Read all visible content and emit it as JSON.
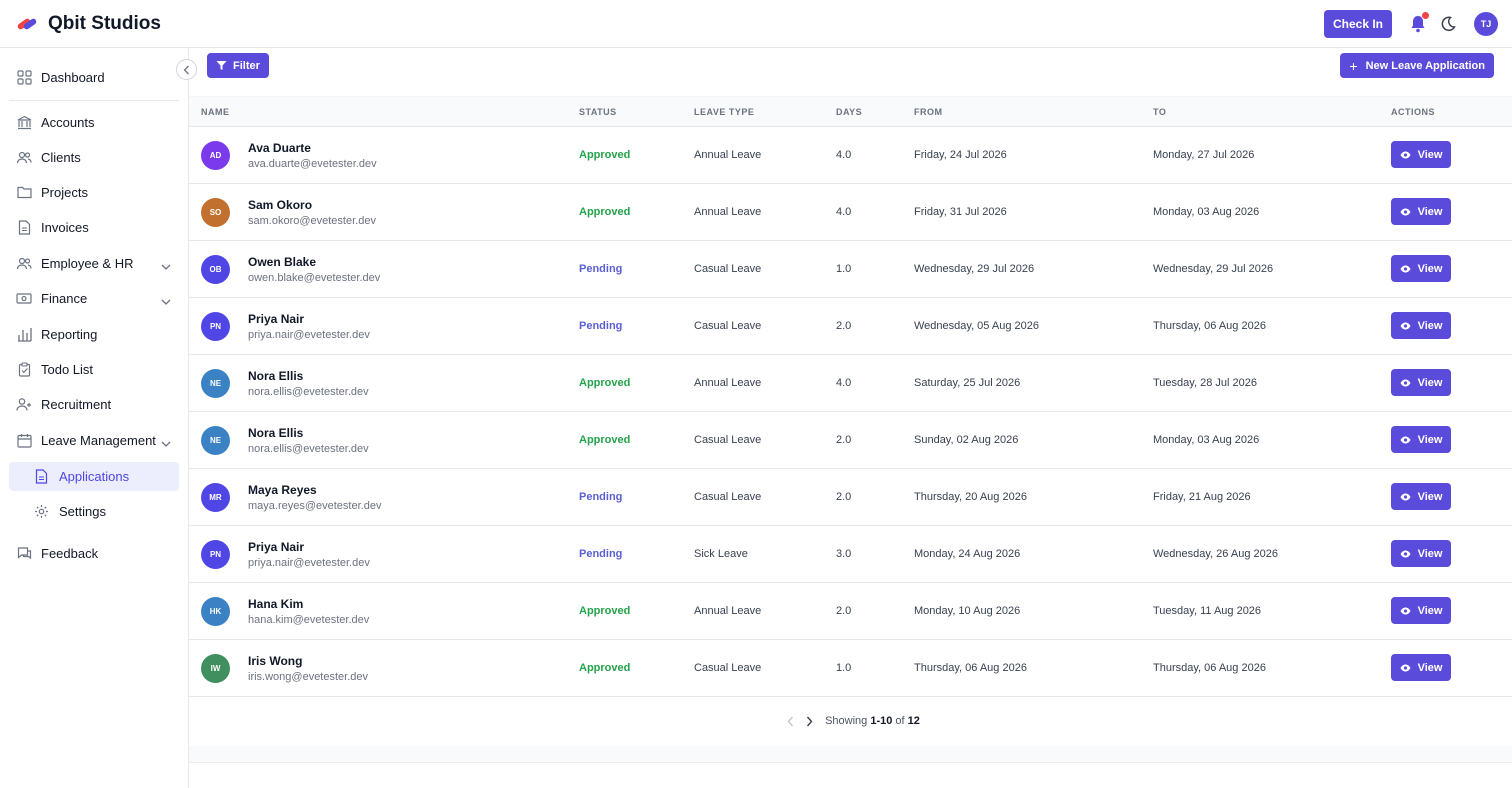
{
  "app": {
    "name": "Qbit Studios",
    "user_initials": "TJ",
    "checkin_label": "Check In"
  },
  "colors": {
    "accent": "#5b4bdb",
    "approved": "#22a34a",
    "pending": "#5b5fd6"
  },
  "sidebar": {
    "items": [
      {
        "label": "Dashboard",
        "icon": "grid-icon"
      },
      {
        "label": "Accounts",
        "icon": "bank-icon"
      },
      {
        "label": "Clients",
        "icon": "users-icon"
      },
      {
        "label": "Projects",
        "icon": "folder-icon"
      },
      {
        "label": "Invoices",
        "icon": "document-icon"
      },
      {
        "label": "Employee & HR",
        "icon": "users-icon",
        "expandable": true
      },
      {
        "label": "Finance",
        "icon": "money-icon",
        "expandable": true
      },
      {
        "label": "Reporting",
        "icon": "bar-chart-icon"
      },
      {
        "label": "Todo List",
        "icon": "clipboard-icon"
      },
      {
        "label": "Recruitment",
        "icon": "user-plus-icon"
      },
      {
        "label": "Leave Management",
        "icon": "calendar-icon",
        "expandable": true
      },
      {
        "label": "Feedback",
        "icon": "chat-icon"
      }
    ],
    "sub_items": [
      {
        "label": "Applications",
        "icon": "document-icon",
        "active": true
      },
      {
        "label": "Settings",
        "icon": "gear-icon"
      }
    ]
  },
  "toolbar": {
    "filter_label": "Filter",
    "new_label": "New Leave Application"
  },
  "table": {
    "columns": [
      "NAME",
      "STATUS",
      "LEAVE TYPE",
      "DAYS",
      "FROM",
      "TO",
      "ACTIONS"
    ],
    "view_label": "View",
    "rows": [
      {
        "initials": "AD",
        "avatar_color": "#7c3aed",
        "name": "Ava Duarte",
        "email": "ava.duarte@evetester.dev",
        "status": "Approved",
        "type": "Annual Leave",
        "days": "4.0",
        "from": "Friday, 24 Jul 2026",
        "to": "Monday, 27 Jul 2026"
      },
      {
        "initials": "SO",
        "avatar_color": "#c2702f",
        "name": "Sam Okoro",
        "email": "sam.okoro@evetester.dev",
        "status": "Approved",
        "type": "Annual Leave",
        "days": "4.0",
        "from": "Friday, 31 Jul 2026",
        "to": "Monday, 03 Aug 2026"
      },
      {
        "initials": "OB",
        "avatar_color": "#4f46e5",
        "name": "Owen Blake",
        "email": "owen.blake@evetester.dev",
        "status": "Pending",
        "type": "Casual Leave",
        "days": "1.0",
        "from": "Wednesday, 29 Jul 2026",
        "to": "Wednesday, 29 Jul 2026"
      },
      {
        "initials": "PN",
        "avatar_color": "#4f46e5",
        "name": "Priya Nair",
        "email": "priya.nair@evetester.dev",
        "status": "Pending",
        "type": "Casual Leave",
        "days": "2.0",
        "from": "Wednesday, 05 Aug 2026",
        "to": "Thursday, 06 Aug 2026"
      },
      {
        "initials": "NE",
        "avatar_color": "#3b82c4",
        "name": "Nora Ellis",
        "email": "nora.ellis@evetester.dev",
        "status": "Approved",
        "type": "Annual Leave",
        "days": "4.0",
        "from": "Saturday, 25 Jul 2026",
        "to": "Tuesday, 28 Jul 2026"
      },
      {
        "initials": "NE",
        "avatar_color": "#3b82c4",
        "name": "Nora Ellis",
        "email": "nora.ellis@evetester.dev",
        "status": "Approved",
        "type": "Casual Leave",
        "days": "2.0",
        "from": "Sunday, 02 Aug 2026",
        "to": "Monday, 03 Aug 2026"
      },
      {
        "initials": "MR",
        "avatar_color": "#4f46e5",
        "name": "Maya Reyes",
        "email": "maya.reyes@evetester.dev",
        "status": "Pending",
        "type": "Casual Leave",
        "days": "2.0",
        "from": "Thursday, 20 Aug 2026",
        "to": "Friday, 21 Aug 2026"
      },
      {
        "initials": "PN",
        "avatar_color": "#4f46e5",
        "name": "Priya Nair",
        "email": "priya.nair@evetester.dev",
        "status": "Pending",
        "type": "Sick Leave",
        "days": "3.0",
        "from": "Monday, 24 Aug 2026",
        "to": "Wednesday, 26 Aug 2026"
      },
      {
        "initials": "HK",
        "avatar_color": "#3b82c4",
        "name": "Hana Kim",
        "email": "hana.kim@evetester.dev",
        "status": "Approved",
        "type": "Annual Leave",
        "days": "2.0",
        "from": "Monday, 10 Aug 2026",
        "to": "Tuesday, 11 Aug 2026"
      },
      {
        "initials": "IW",
        "avatar_color": "#3f8f5f",
        "name": "Iris Wong",
        "email": "iris.wong@evetester.dev",
        "status": "Approved",
        "type": "Casual Leave",
        "days": "1.0",
        "from": "Thursday, 06 Aug 2026",
        "to": "Thursday, 06 Aug 2026"
      }
    ]
  },
  "pagination": {
    "prefix": "Showing",
    "range": "1-10",
    "of_label": "of",
    "total": "12"
  }
}
